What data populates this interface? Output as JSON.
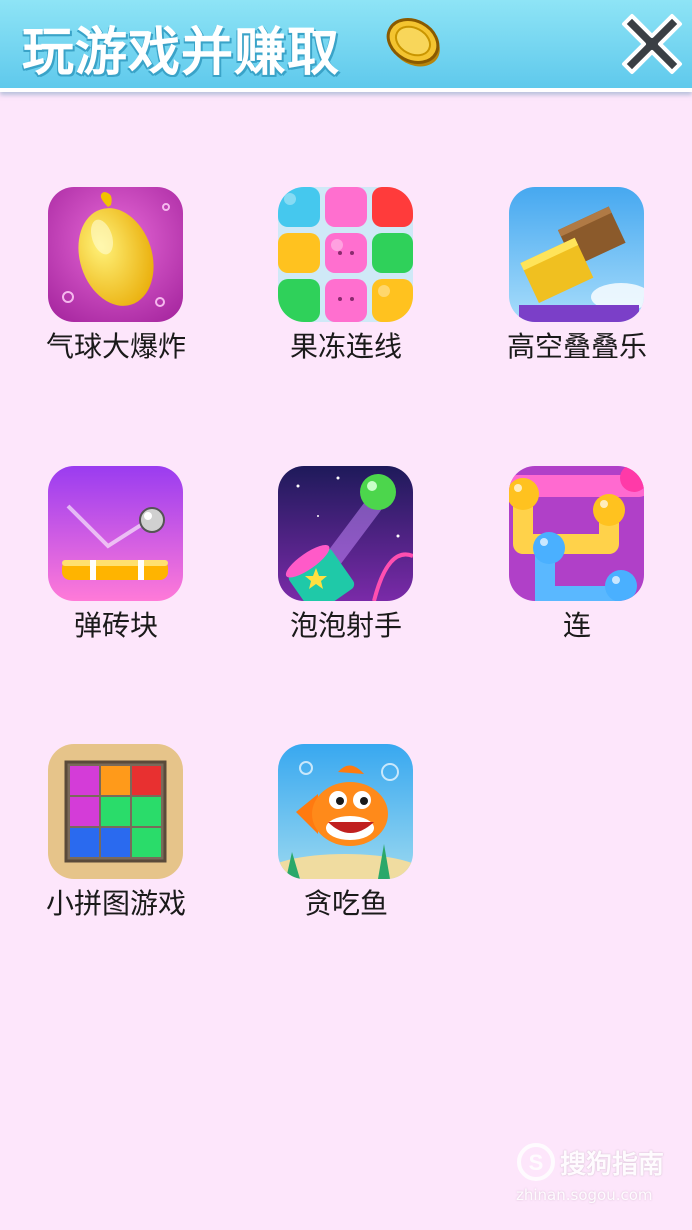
{
  "header": {
    "title": "玩游戏并赚取",
    "coin_icon": "coin-icon",
    "close_icon": "close-icon",
    "background_color": "#6fd3f0"
  },
  "background_color": "#fde6fb",
  "games": [
    {
      "label": "气球大爆炸",
      "icon": "yellow-balloon-icon"
    },
    {
      "label": "果冻连线",
      "icon": "jelly-cats-icon"
    },
    {
      "label": "高空叠叠乐",
      "icon": "stacked-blocks-icon"
    },
    {
      "label": "弹砖块",
      "icon": "bouncing-ball-paddle-icon"
    },
    {
      "label": "泡泡射手",
      "icon": "bubble-cannon-icon"
    },
    {
      "label": "连",
      "icon": "connect-dots-icon"
    },
    {
      "label": "小拼图游戏",
      "icon": "block-puzzle-icon"
    },
    {
      "label": "贪吃鱼",
      "icon": "orange-fish-icon"
    }
  ],
  "watermark": {
    "text": "搜狗指南",
    "url": "zhinan.sogou.com"
  }
}
